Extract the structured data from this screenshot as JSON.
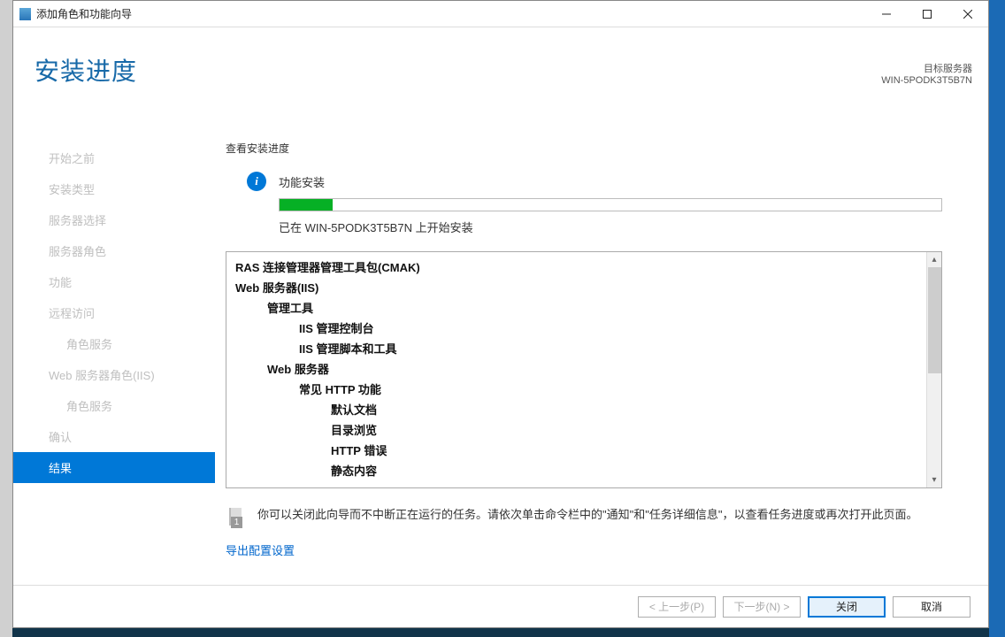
{
  "window": {
    "title": "添加角色和功能向导"
  },
  "header": {
    "title": "安装进度",
    "target_label": "目标服务器",
    "target_server": "WIN-5PODK3T5B7N"
  },
  "sidebar": {
    "steps": [
      {
        "label": "开始之前",
        "active": false,
        "sub": false
      },
      {
        "label": "安装类型",
        "active": false,
        "sub": false
      },
      {
        "label": "服务器选择",
        "active": false,
        "sub": false
      },
      {
        "label": "服务器角色",
        "active": false,
        "sub": false
      },
      {
        "label": "功能",
        "active": false,
        "sub": false
      },
      {
        "label": "远程访问",
        "active": false,
        "sub": false
      },
      {
        "label": "角色服务",
        "active": false,
        "sub": true
      },
      {
        "label": "Web 服务器角色(IIS)",
        "active": false,
        "sub": false
      },
      {
        "label": "角色服务",
        "active": false,
        "sub": true
      },
      {
        "label": "确认",
        "active": false,
        "sub": false
      },
      {
        "label": "结果",
        "active": true,
        "sub": false
      }
    ]
  },
  "content": {
    "section_title": "查看安装进度",
    "info_text": "功能安装",
    "progress_percent": 8,
    "status_text": "已在 WIN-5PODK3T5B7N 上开始安装",
    "tree": [
      {
        "lvl": 0,
        "text": "RAS 连接管理器管理工具包(CMAK)"
      },
      {
        "lvl": 0,
        "text": "Web 服务器(IIS)"
      },
      {
        "lvl": 1,
        "text": "管理工具"
      },
      {
        "lvl": 2,
        "text": "IIS 管理控制台"
      },
      {
        "lvl": 2,
        "text": "IIS 管理脚本和工具"
      },
      {
        "lvl": 1,
        "text": "Web 服务器"
      },
      {
        "lvl": 2,
        "text": "常见 HTTP 功能"
      },
      {
        "lvl": 3,
        "text": "默认文档"
      },
      {
        "lvl": 3,
        "text": "目录浏览"
      },
      {
        "lvl": 3,
        "text": "HTTP 错误"
      },
      {
        "lvl": 3,
        "text": "静态内容"
      }
    ],
    "note_badge": "1",
    "note_text": "你可以关闭此向导而不中断正在运行的任务。请依次单击命令栏中的\"通知\"和\"任务详细信息\"，以查看任务进度或再次打开此页面。",
    "export_link": "导出配置设置"
  },
  "footer": {
    "prev": "< 上一步(P)",
    "next": "下一步(N) >",
    "close": "关闭",
    "cancel": "取消"
  }
}
